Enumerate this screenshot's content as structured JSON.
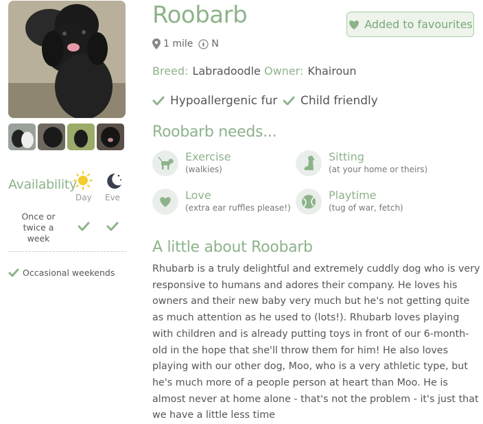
{
  "profile": {
    "name": "Roobarb",
    "favourite_label": "Added to favourites",
    "distance": "1 mile",
    "direction": "N",
    "breed_label": "Breed:",
    "breed": "Labradoodle",
    "owner_label": "Owner:",
    "owner": "Khairoun",
    "features": [
      "Hypoallergenic fur",
      "Child friendly"
    ]
  },
  "availability": {
    "title": "Availability",
    "day_label": "Day",
    "eve_label": "Eve",
    "frequency": "Once or twice a week",
    "extra": "Occasional weekends"
  },
  "needs": {
    "title": "Roobarb needs...",
    "items": [
      {
        "title": "Exercise",
        "sub": "(walkies)",
        "icon": "dog-walk-icon"
      },
      {
        "title": "Sitting",
        "sub": "(at your home or theirs)",
        "icon": "dog-sit-icon"
      },
      {
        "title": "Love",
        "sub": "(extra ear ruffles please!)",
        "icon": "heart-icon"
      },
      {
        "title": "Playtime",
        "sub": "(tug of war, fetch)",
        "icon": "ball-icon"
      }
    ]
  },
  "about": {
    "title": "A little about Roobarb",
    "text": "Rhubarb is a truly delightful and extremely cuddly dog who is very responsive to humans and adores their company. He loves his owners and their new baby very much but he's not getting quite as much attention as he used to (lots!). Rhubarb loves playing with children and is already putting toys in front of our 6-month-old in the hope that she'll throw them for him! He also loves playing with our other dog, Moo, who is a very athletic type, but he's much more of a people person at heart than Moo. He is almost never at home alone - that's not the problem - it's just that we have a little less time"
  },
  "colors": {
    "accent": "#8db38a",
    "text": "#555555"
  }
}
